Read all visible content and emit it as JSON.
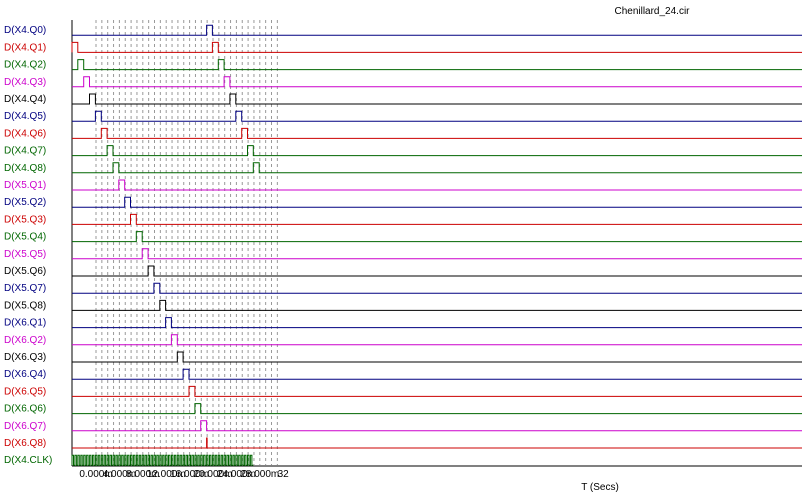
{
  "chart_data": {
    "type": "line",
    "title": "Chenillard_24.cir",
    "xlabel": "T (Secs)",
    "ylabel": "",
    "xlim": [
      0,
      0.031
    ],
    "x_ticks": [
      {
        "value": 0,
        "label": "0.000m"
      },
      {
        "value": 0.004,
        "label": "4.000m"
      },
      {
        "value": 0.008,
        "label": "8.000m"
      },
      {
        "value": 0.012,
        "label": "12.000m"
      },
      {
        "value": 0.016,
        "label": "16.000m"
      },
      {
        "value": 0.02,
        "label": "20.000m"
      },
      {
        "value": 0.024,
        "label": "24.000m"
      },
      {
        "value": 0.028,
        "label": "28.000m"
      },
      {
        "value": 0.032,
        "label": "32"
      }
    ],
    "grid": true,
    "series": [
      {
        "name": "D(X4.Q0)",
        "color": "#000080",
        "high": [
          [
            0.023,
            0.024
          ]
        ]
      },
      {
        "name": "D(X4.Q1)",
        "color": "#cc0000",
        "high": [
          [
            0.0,
            0.001
          ],
          [
            0.024,
            0.025
          ]
        ]
      },
      {
        "name": "D(X4.Q2)",
        "color": "#006600",
        "high": [
          [
            0.001,
            0.002
          ],
          [
            0.025,
            0.026
          ]
        ]
      },
      {
        "name": "D(X4.Q3)",
        "color": "#cc00cc",
        "high": [
          [
            0.002,
            0.003
          ],
          [
            0.026,
            0.027
          ]
        ]
      },
      {
        "name": "D(X4.Q4)",
        "color": "#000000",
        "high": [
          [
            0.003,
            0.004
          ],
          [
            0.027,
            0.028
          ]
        ]
      },
      {
        "name": "D(X4.Q5)",
        "color": "#000080",
        "high": [
          [
            0.004,
            0.005
          ],
          [
            0.028,
            0.029
          ]
        ]
      },
      {
        "name": "D(X4.Q6)",
        "color": "#cc0000",
        "high": [
          [
            0.005,
            0.006
          ],
          [
            0.029,
            0.03
          ]
        ]
      },
      {
        "name": "D(X4.Q7)",
        "color": "#006600",
        "high": [
          [
            0.006,
            0.007
          ],
          [
            0.03,
            0.031
          ]
        ]
      },
      {
        "name": "D(X4.Q8)",
        "color": "#006600",
        "high": [
          [
            0.007,
            0.008
          ],
          [
            0.031,
            0.032
          ]
        ]
      },
      {
        "name": "D(X5.Q1)",
        "color": "#cc00cc",
        "high": [
          [
            0.008,
            0.009
          ]
        ]
      },
      {
        "name": "D(X5.Q2)",
        "color": "#000080",
        "high": [
          [
            0.009,
            0.01
          ]
        ]
      },
      {
        "name": "D(X5.Q3)",
        "color": "#cc0000",
        "high": [
          [
            0.01,
            0.011
          ]
        ]
      },
      {
        "name": "D(X5.Q4)",
        "color": "#006600",
        "high": [
          [
            0.011,
            0.012
          ]
        ]
      },
      {
        "name": "D(X5.Q5)",
        "color": "#cc00cc",
        "high": [
          [
            0.012,
            0.013
          ]
        ]
      },
      {
        "name": "D(X5.Q6)",
        "color": "#000000",
        "high": [
          [
            0.013,
            0.014
          ]
        ]
      },
      {
        "name": "D(X5.Q7)",
        "color": "#000080",
        "high": [
          [
            0.014,
            0.015
          ]
        ]
      },
      {
        "name": "D(X5.Q8)",
        "color": "#000000",
        "high": [
          [
            0.015,
            0.016
          ]
        ]
      },
      {
        "name": "D(X6.Q1)",
        "color": "#000080",
        "high": [
          [
            0.016,
            0.017
          ]
        ]
      },
      {
        "name": "D(X6.Q2)",
        "color": "#cc00cc",
        "high": [
          [
            0.017,
            0.018
          ]
        ]
      },
      {
        "name": "D(X6.Q3)",
        "color": "#000000",
        "high": [
          [
            0.018,
            0.019
          ]
        ]
      },
      {
        "name": "D(X6.Q4)",
        "color": "#000080",
        "high": [
          [
            0.019,
            0.02
          ]
        ]
      },
      {
        "name": "D(X6.Q5)",
        "color": "#cc0000",
        "high": [
          [
            0.02,
            0.021
          ]
        ]
      },
      {
        "name": "D(X6.Q6)",
        "color": "#006600",
        "high": [
          [
            0.021,
            0.022
          ]
        ]
      },
      {
        "name": "D(X6.Q7)",
        "color": "#cc00cc",
        "high": [
          [
            0.022,
            0.023
          ]
        ]
      },
      {
        "name": "D(X6.Q8)",
        "color": "#cc0000",
        "high": [
          [
            0.023,
            0.0231
          ]
        ]
      },
      {
        "name": "D(X4.CLK)",
        "color": "#006600",
        "clock_period": 0.0005,
        "clock_start": 0.0
      }
    ]
  }
}
